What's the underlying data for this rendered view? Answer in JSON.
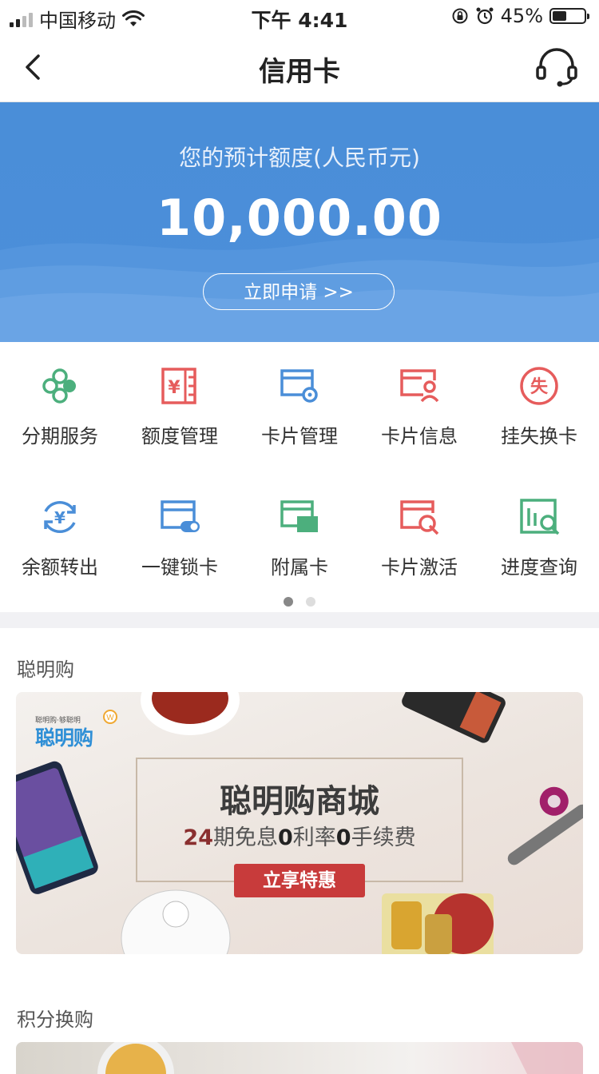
{
  "status_bar": {
    "carrier": "中国移动",
    "time": "下午 4:41",
    "battery": "45%",
    "battery_level": 0.45
  },
  "nav": {
    "title": "信用卡"
  },
  "banner": {
    "label": "您的预计额度(人民币元)",
    "amount": "10,000.00",
    "apply_button": "立即申请 >>"
  },
  "services": [
    {
      "label": "分期服务",
      "icon": "installment-icon",
      "color": "#4caf7d"
    },
    {
      "label": "额度管理",
      "icon": "limit-management-icon",
      "color": "#e65c5c"
    },
    {
      "label": "卡片管理",
      "icon": "card-management-icon",
      "color": "#4a8ed8"
    },
    {
      "label": "卡片信息",
      "icon": "card-info-icon",
      "color": "#e65c5c"
    },
    {
      "label": "挂失换卡",
      "icon": "report-loss-icon",
      "color": "#e65c5c",
      "glyph": "失"
    },
    {
      "label": "余额转出",
      "icon": "balance-transfer-icon",
      "color": "#4a8ed8",
      "glyph": "¥"
    },
    {
      "label": "一键锁卡",
      "icon": "lock-card-icon",
      "color": "#4a8ed8"
    },
    {
      "label": "附属卡",
      "icon": "supplementary-card-icon",
      "color": "#4caf7d"
    },
    {
      "label": "卡片激活",
      "icon": "card-activation-icon",
      "color": "#e65c5c"
    },
    {
      "label": "进度查询",
      "icon": "progress-query-icon",
      "color": "#4caf7d"
    }
  ],
  "pagination": {
    "pages": 2,
    "current": 1
  },
  "smart_shop": {
    "section_title": "聪明购",
    "logo_small": "聪明购·够聪明",
    "logo_big": "聪明购",
    "headline": "聪明购商城",
    "sub_parts": [
      "24",
      "期免息",
      "0",
      "利率",
      "0",
      "手续费"
    ],
    "cta": "立享特惠"
  },
  "points": {
    "section_title": "积分换购"
  }
}
